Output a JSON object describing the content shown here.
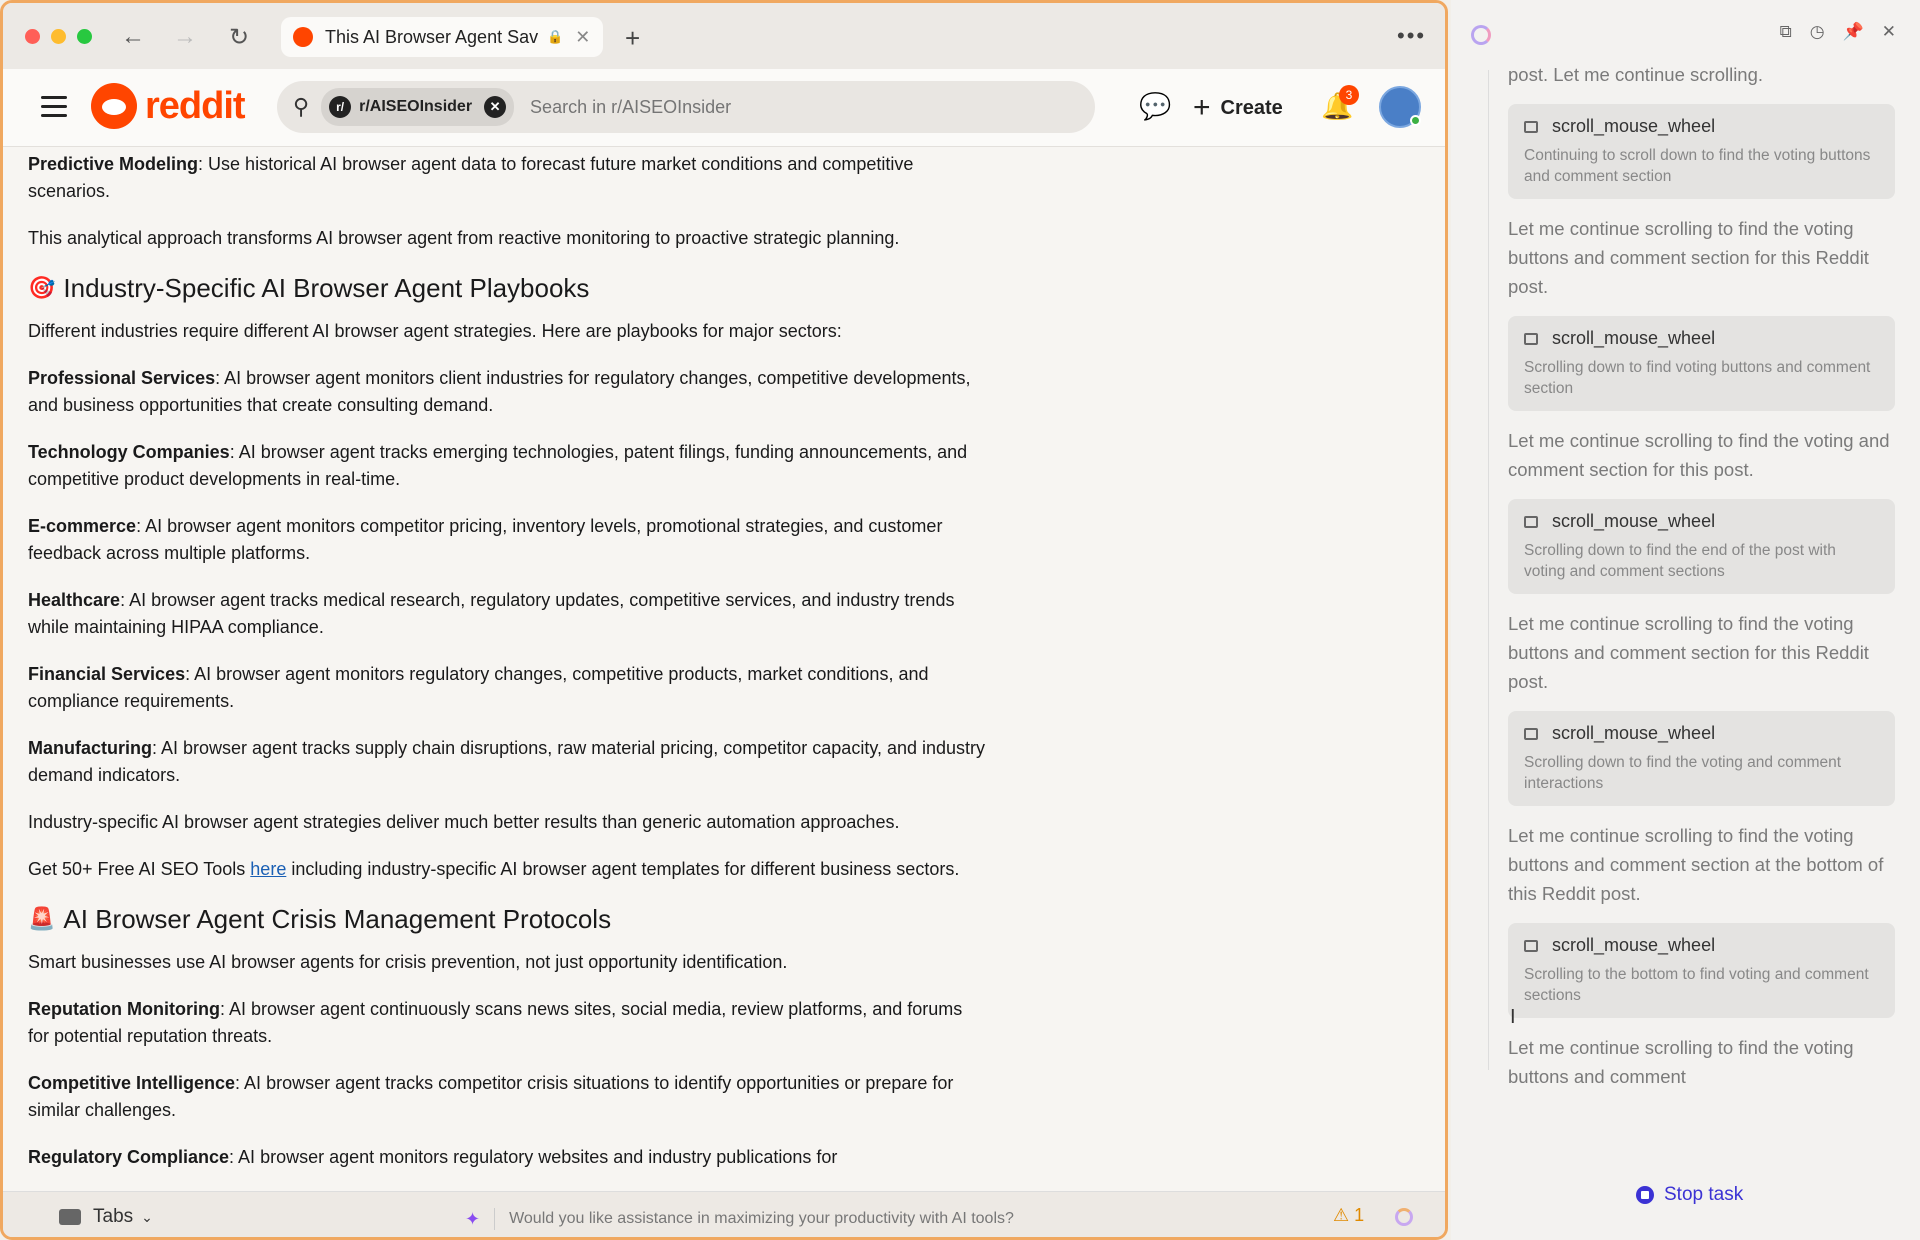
{
  "browser": {
    "tab_title": "This AI Browser Agent Sav",
    "colors": {
      "accent": "#ff4500",
      "link": "#1a5fb4",
      "agent": "#3b32d4"
    }
  },
  "reddit": {
    "logo_text": "reddit",
    "subreddit_chip": "r/AISEOInsider",
    "search_placeholder": "Search in r/AISEOInsider",
    "create_label": "Create",
    "notification_count": "3"
  },
  "article": {
    "p1_bold": "Predictive Modeling",
    "p1_text": ": Use historical AI browser agent data to forecast future market conditions and competitive scenarios.",
    "p2": "This analytical approach transforms AI browser agent from reactive monitoring to proactive strategic planning.",
    "h1": "Industry-Specific AI Browser Agent Playbooks",
    "h1_intro": "Different industries require different AI browser agent strategies. Here are playbooks for major sectors:",
    "sectors": [
      {
        "name": "Professional Services",
        "text": ": AI browser agent monitors client industries for regulatory changes, competitive developments, and business opportunities that create consulting demand."
      },
      {
        "name": "Technology Companies",
        "text": ": AI browser agent tracks emerging technologies, patent filings, funding announcements, and competitive product developments in real-time."
      },
      {
        "name": "E-commerce",
        "text": ": AI browser agent monitors competitor pricing, inventory levels, promotional strategies, and customer feedback across multiple platforms."
      },
      {
        "name": "Healthcare",
        "text": ": AI browser agent tracks medical research, regulatory updates, competitive services, and industry trends while maintaining HIPAA compliance."
      },
      {
        "name": "Financial Services",
        "text": ": AI browser agent monitors regulatory changes, competitive products, market conditions, and compliance requirements."
      },
      {
        "name": "Manufacturing",
        "text": ": AI browser agent tracks supply chain disruptions, raw material pricing, competitor capacity, and industry demand indicators."
      }
    ],
    "p_industry": "Industry-specific AI browser agent strategies deliver much better results than generic automation approaches.",
    "tools_pre": "Get 50+ Free AI SEO Tools ",
    "tools_link": "here",
    "tools_post": " including industry-specific AI browser agent templates for different business sectors.",
    "h2": "AI Browser Agent Crisis Management Protocols",
    "h2_intro": "Smart businesses use AI browser agents for crisis prevention, not just opportunity identification.",
    "crisis": [
      {
        "name": "Reputation Monitoring",
        "text": ": AI browser agent continuously scans news sites, social media, review platforms, and forums for potential reputation threats."
      },
      {
        "name": "Competitive Intelligence",
        "text": ": AI browser agent tracks competitor crisis situations to identify opportunities or prepare for similar challenges."
      },
      {
        "name": "Regulatory Compliance",
        "text": ": AI browser agent monitors regulatory websites and industry publications for"
      }
    ]
  },
  "bottombar": {
    "tabs_label": "Tabs",
    "assist_text": "Would you like assistance in maximizing your productivity with AI tools?",
    "warning_count": "1"
  },
  "panel": {
    "top_text": "post. Let me continue scrolling.",
    "steps": [
      {
        "tool": "scroll_mouse_wheel",
        "desc": "Continuing to scroll down to find the voting buttons and comment section",
        "after": "Let me continue scrolling to find the voting buttons and comment section for this Reddit post."
      },
      {
        "tool": "scroll_mouse_wheel",
        "desc": "Scrolling down to find voting buttons and comment section",
        "after": "Let me continue scrolling to find the voting and comment section for this post."
      },
      {
        "tool": "scroll_mouse_wheel",
        "desc": "Scrolling down to find the end of the post with voting and comment sections",
        "after": "Let me continue scrolling to find the voting buttons and comment section for this Reddit post."
      },
      {
        "tool": "scroll_mouse_wheel",
        "desc": "Scrolling down to find the voting and comment interactions",
        "after": "Let me continue scrolling to find the voting buttons and comment section at the bottom of this Reddit post."
      },
      {
        "tool": "scroll_mouse_wheel",
        "desc": "Scrolling to the bottom to find voting and comment sections",
        "after": "Let me continue scrolling to find the voting buttons and comment"
      }
    ],
    "stop_label": "Stop task"
  }
}
